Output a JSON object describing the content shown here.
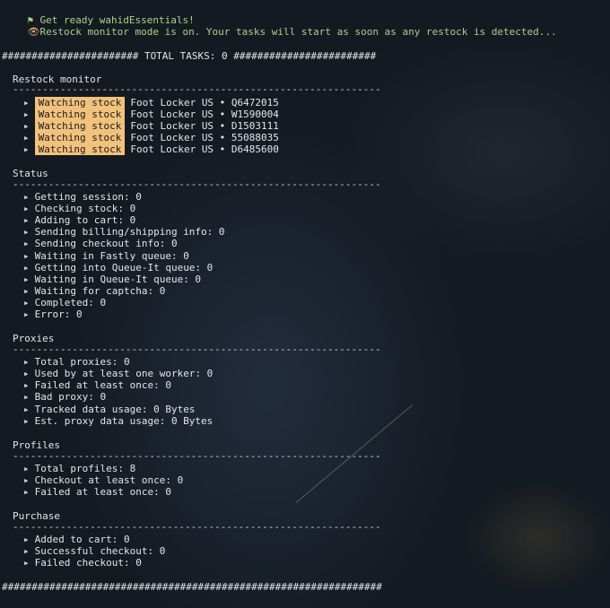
{
  "notices": {
    "ready": "Get ready wahidEssentials!",
    "restock": "Restock monitor mode is on. Your tasks will start as soon as any restock is detected..."
  },
  "header": "####################### TOTAL TASKS: 0 ########################",
  "footer": "################################################################",
  "rule": "--------------------------------------------------------------",
  "restock_monitor": {
    "title": "Restock monitor",
    "items": [
      {
        "tag": "Watching stock",
        "text": "Foot Locker US • Q6472015"
      },
      {
        "tag": "Watching stock",
        "text": "Foot Locker US • W1590004"
      },
      {
        "tag": "Watching stock",
        "text": "Foot Locker US • D1503111"
      },
      {
        "tag": "Watching stock",
        "text": "Foot Locker US • 55088035"
      },
      {
        "tag": "Watching stock",
        "text": "Foot Locker US • D6485600"
      }
    ]
  },
  "status": {
    "title": "Status",
    "items": [
      "Getting session: 0",
      "Checking stock: 0",
      "Adding to cart: 0",
      "Sending billing/shipping info: 0",
      "Sending checkout info: 0",
      "Waiting in Fastly queue: 0",
      "Getting into Queue-It queue: 0",
      "Waiting in Queue-It queue: 0",
      "Waiting for captcha: 0",
      "Completed: 0",
      "Error: 0"
    ]
  },
  "proxies": {
    "title": "Proxies",
    "items": [
      "Total proxies: 0",
      "Used by at least one worker: 0",
      "Failed at least once: 0",
      "Bad proxy: 0",
      "Tracked data usage: 0 Bytes",
      "Est. proxy data usage: 0 Bytes"
    ]
  },
  "profiles": {
    "title": "Profiles",
    "items": [
      "Total profiles: 8",
      "Checkout at least once: 0",
      "Failed at least once: 0"
    ]
  },
  "purchase": {
    "title": "Purchase",
    "items": [
      "Added to cart: 0",
      "Successful checkout: 0",
      "Failed checkout: 0"
    ]
  },
  "icons": {
    "flag": "flag-icon",
    "eye": "eye-icon",
    "bullet": "play-bullet-icon"
  },
  "colors": {
    "background": "#141a22",
    "notice_text": "#a9d486",
    "highlight": "#f2c27d",
    "text": "#e3e6ea"
  }
}
